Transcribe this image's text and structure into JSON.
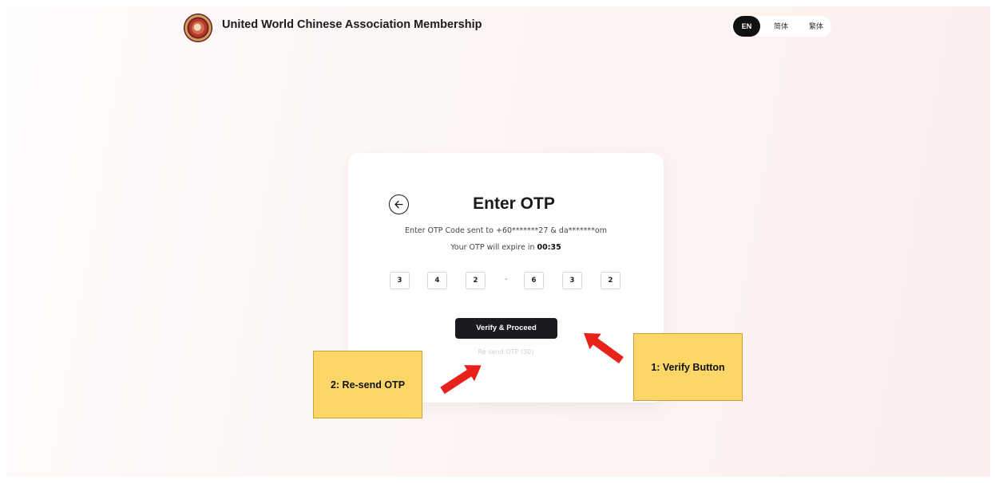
{
  "header": {
    "app_title": "United World Chinese Association Membership",
    "languages": [
      "EN",
      "简体",
      "繁体"
    ],
    "active_language": "EN"
  },
  "otp_card": {
    "title": "Enter OTP",
    "sent_to": "Enter OTP Code sent to +60*******27 & da*******om",
    "expire_prefix": "Your OTP will expire in ",
    "expire_time": "00:35",
    "digits": [
      "3",
      "4",
      "2",
      "6",
      "3",
      "2"
    ],
    "separator": "-",
    "verify_label": "Verify & Proceed",
    "resend_label": "Re-send OTP (30)"
  },
  "annotations": {
    "resend_note": "2: Re-send OTP",
    "verify_note": "1: Verify Button",
    "arrow_color": "#e8211b",
    "note_color": "#fdd668"
  },
  "colors": {
    "primary_button": "#1a1b1f",
    "active_language_pill": "#111111"
  }
}
